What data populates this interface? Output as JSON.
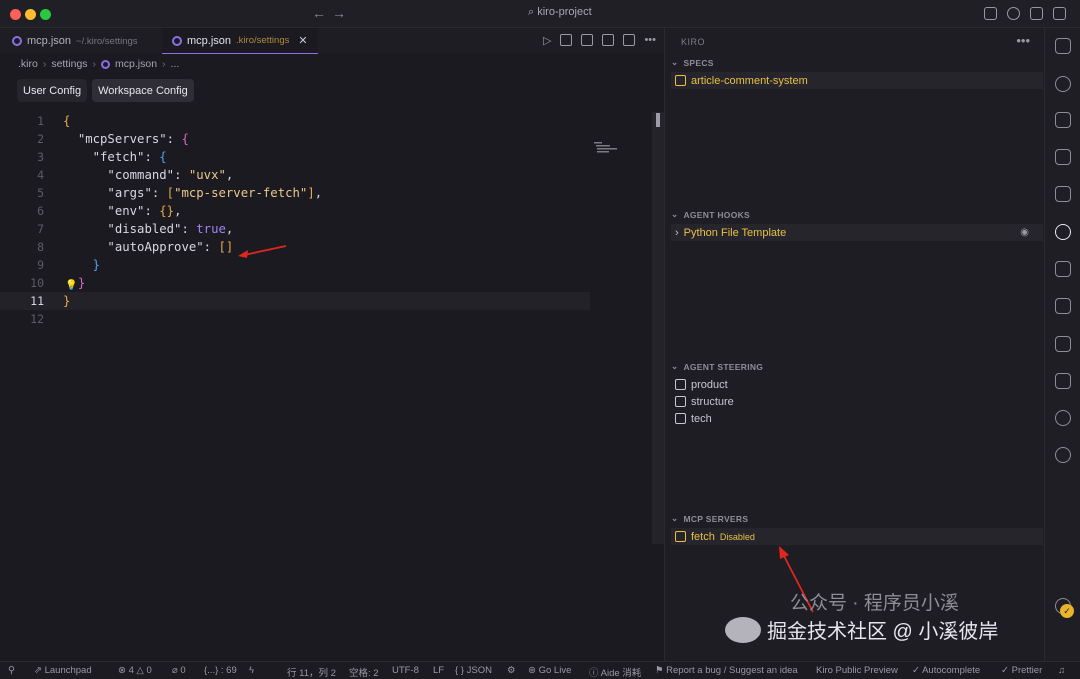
{
  "window": {
    "search_text": "kiro-project"
  },
  "tabs": [
    {
      "name": "mcp.json",
      "path": "~/.kiro/settings"
    },
    {
      "name": "mcp.json",
      "path": ".kiro/settings",
      "close": "✕"
    }
  ],
  "breadcrumb": {
    "parts": [
      ".kiro",
      "settings",
      "mcp.json",
      "..."
    ]
  },
  "config_buttons": {
    "user": "User Config",
    "workspace": "Workspace Config"
  },
  "editor": {
    "line_numbers": [
      "1",
      "2",
      "3",
      "4",
      "5",
      "6",
      "7",
      "8",
      "9",
      "10",
      "11",
      "12"
    ],
    "current_line": "11"
  },
  "panel": {
    "title": "KIRO",
    "more": "•••",
    "specs": {
      "header": "SPECS",
      "items": [
        "article-comment-system"
      ]
    },
    "hooks": {
      "header": "AGENT HOOKS",
      "items": [
        "Python File Template"
      ]
    },
    "steering": {
      "header": "AGENT STEERING",
      "items": [
        "product",
        "structure",
        "tech"
      ]
    },
    "mcp": {
      "header": "MCP SERVERS",
      "server": "fetch",
      "status": "Disabled"
    }
  },
  "watermark": {
    "main": "掘金技术社区 @ 小溪彼岸",
    "sub": "公众号 · 程序员小溪"
  },
  "statusbar": {
    "launchpad": "Launchpad",
    "errors": "⊗ 4 △ 0",
    "ports": "⌀ 0",
    "scope": "{...} : 69",
    "position": "行 11，列 2",
    "spaces": "空格: 2",
    "encoding": "UTF-8",
    "eol": "LF",
    "language": "{ } JSON",
    "golive": "Go Live",
    "aide": "Aide 消耗",
    "report": "Report a bug / Suggest an idea",
    "preview": "Kiro Public Preview",
    "autocomplete": "Autocomplete",
    "prettier": "Prettier"
  },
  "colors": {
    "accent": "#8b6fe6",
    "gold": "#eac048",
    "background": "#1b1a20"
  }
}
